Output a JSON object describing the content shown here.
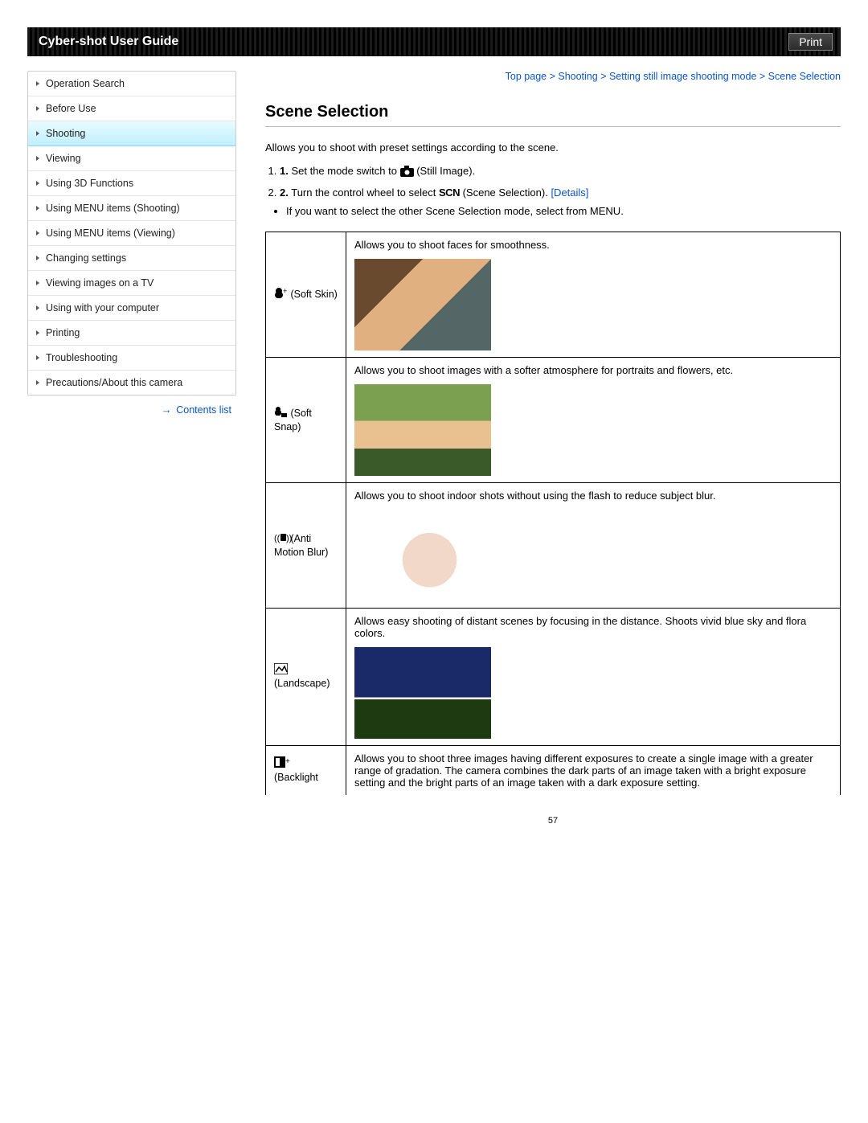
{
  "header": {
    "title": "Cyber-shot User Guide",
    "print": "Print"
  },
  "nav": {
    "items": [
      "Operation Search",
      "Before Use",
      "Shooting",
      "Viewing",
      "Using 3D Functions",
      "Using MENU items (Shooting)",
      "Using MENU items (Viewing)",
      "Changing settings",
      "Viewing images on a TV",
      "Using with your computer",
      "Printing",
      "Troubleshooting",
      "Precautions/About this camera"
    ],
    "active_index": 2,
    "contents_link": "Contents list"
  },
  "breadcrumb": {
    "parts": [
      "Top page",
      "Shooting",
      "Setting still image shooting mode",
      "Scene Selection"
    ]
  },
  "page": {
    "heading": "Scene Selection",
    "intro": "Allows you to shoot with preset settings according to the scene.",
    "steps": [
      {
        "num": "1.",
        "pre": "Set the mode switch to ",
        "icon": "camera-icon",
        "post": " (Still Image)."
      },
      {
        "num": "2.",
        "pre": "Turn the control wheel to select ",
        "icon": "scn-icon",
        "post": " (Scene Selection). ",
        "link": "[Details]"
      }
    ],
    "bullet": "If you want to select the other Scene Selection mode, select from MENU.",
    "modes": [
      {
        "icon": "soft-skin-icon",
        "label": " (Soft Skin)",
        "desc": "Allows you to shoot faces for smoothness.",
        "thumb": "portrait1"
      },
      {
        "icon": "soft-snap-icon",
        "label": " (Soft Snap)",
        "desc": "Allows you to shoot images with a softer atmosphere for portraits and flowers, etc.",
        "thumb": "portrait2"
      },
      {
        "icon": "anti-blur-icon",
        "label": " (Anti Motion Blur)",
        "desc": "Allows you to shoot indoor shots without using the flash to reduce subject blur.",
        "thumb": "indoor"
      },
      {
        "icon": "landscape-icon",
        "label": " (Landscape)",
        "desc": "Allows easy shooting of distant scenes by focusing in the distance. Shoots vivid blue sky and flora colors.",
        "thumb": "land"
      },
      {
        "icon": "backlight-icon",
        "label": " (Backlight",
        "desc": "Allows you to shoot three images having different exposures to create a single image with a greater range of gradation. The camera combines the dark parts of an image taken with a bright exposure setting and the bright parts of an image taken with a dark exposure setting.",
        "thumb": ""
      }
    ],
    "pagenum": "57"
  }
}
